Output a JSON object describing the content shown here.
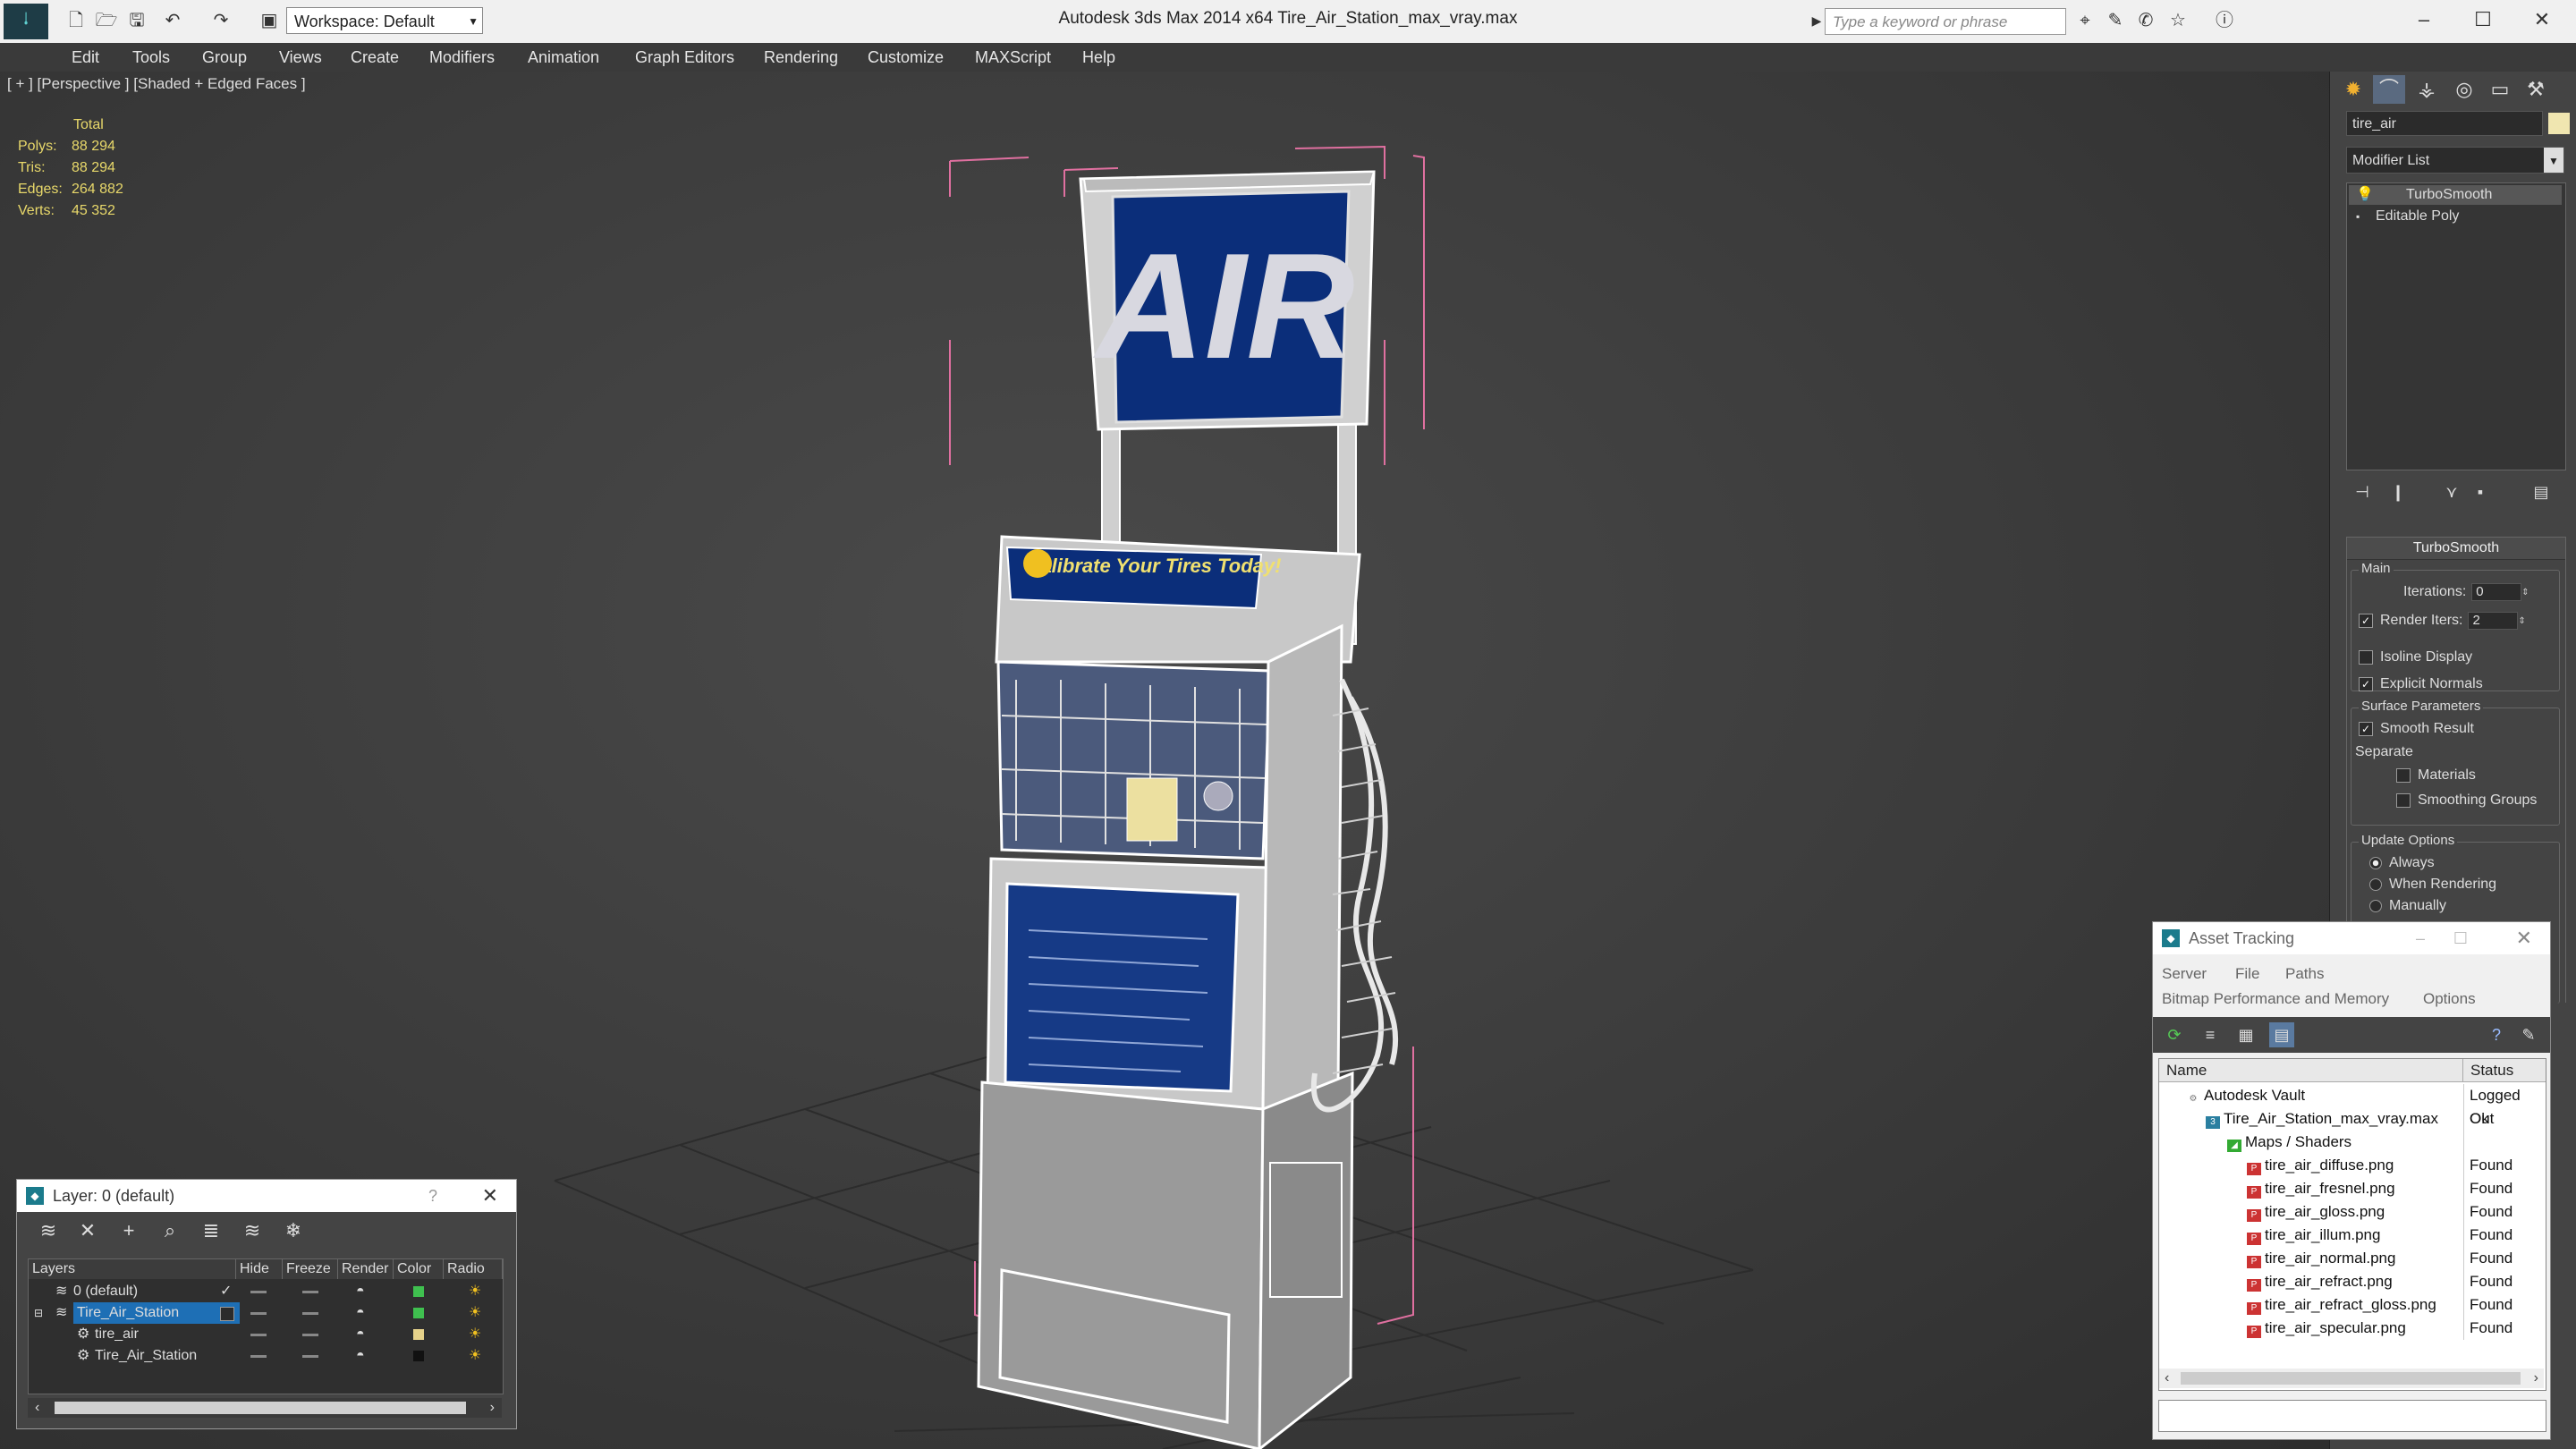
{
  "titlebar": {
    "workspace": "Workspace: Default",
    "app_title": "Autodesk 3ds Max  2014 x64      Tire_Air_Station_max_vray.max",
    "search_placeholder": "Type a keyword or phrase"
  },
  "menu": [
    "Edit",
    "Tools",
    "Group",
    "Views",
    "Create",
    "Modifiers",
    "Animation",
    "Graph Editors",
    "Rendering",
    "Customize",
    "MAXScript",
    "Help"
  ],
  "viewport": {
    "label": "[ + ] [Perspective ] [Shaded + Edged Faces ]",
    "stats": {
      "header": "Total",
      "polys_label": "Polys:",
      "polys": "88 294",
      "tris_label": "Tris:",
      "tris": "88 294",
      "edges_label": "Edges:",
      "edges": "264 882",
      "verts_label": "Verts:",
      "verts": "45 352"
    },
    "sign_text": "AIR",
    "banner_text": "Calibrate Your Tires Today!"
  },
  "command_panel": {
    "object_name": "tire_air",
    "object_color": "#f0e6b0",
    "modifier_list": "Modifier List",
    "stack": [
      "TurboSmooth",
      "Editable Poly"
    ],
    "turbosmooth": {
      "title": "TurboSmooth",
      "main_title": "Main",
      "iterations_label": "Iterations:",
      "iterations": "0",
      "render_iters_label": "Render Iters:",
      "render_iters": "2",
      "isoline": "Isoline Display",
      "explicit_normals": "Explicit Normals",
      "surface_title": "Surface Parameters",
      "smooth_result": "Smooth Result",
      "separate": "Separate",
      "materials": "Materials",
      "smoothing_groups": "Smoothing Groups",
      "update_title": "Update Options",
      "always": "Always",
      "when_rendering": "When Rendering",
      "manually": "Manually"
    }
  },
  "layer_window": {
    "title": "Layer: 0 (default)",
    "help": "?",
    "columns": [
      "Layers",
      "Hide",
      "Freeze",
      "Render",
      "Color",
      "Radio"
    ],
    "rows": [
      {
        "name": "0 (default)",
        "color": "#3fc04f"
      },
      {
        "name": "Tire_Air_Station",
        "color": "#3fc04f"
      },
      {
        "name": "tire_air",
        "color": "#e6d28a"
      },
      {
        "name": "Tire_Air_Station",
        "color": "#111111"
      }
    ]
  },
  "asset_tracking": {
    "title": "Asset Tracking",
    "menu": [
      "Server",
      "File",
      "Paths"
    ],
    "menu2": [
      "Bitmap Performance and Memory",
      "Options"
    ],
    "columns": [
      "Name",
      "Status"
    ],
    "rows": [
      {
        "name": "Autodesk Vault",
        "status": "Logged Out",
        "indent": 0
      },
      {
        "name": "Tire_Air_Station_max_vray.max",
        "status": "Ok",
        "indent": 1
      },
      {
        "name": "Maps / Shaders",
        "status": "",
        "indent": 2
      },
      {
        "name": "tire_air_diffuse.png",
        "status": "Found",
        "indent": 3
      },
      {
        "name": "tire_air_fresnel.png",
        "status": "Found",
        "indent": 3
      },
      {
        "name": "tire_air_gloss.png",
        "status": "Found",
        "indent": 3
      },
      {
        "name": "tire_air_illum.png",
        "status": "Found",
        "indent": 3
      },
      {
        "name": "tire_air_normal.png",
        "status": "Found",
        "indent": 3
      },
      {
        "name": "tire_air_refract.png",
        "status": "Found",
        "indent": 3
      },
      {
        "name": "tire_air_refract_gloss.png",
        "status": "Found",
        "indent": 3
      },
      {
        "name": "tire_air_specular.png",
        "status": "Found",
        "indent": 3
      }
    ]
  }
}
